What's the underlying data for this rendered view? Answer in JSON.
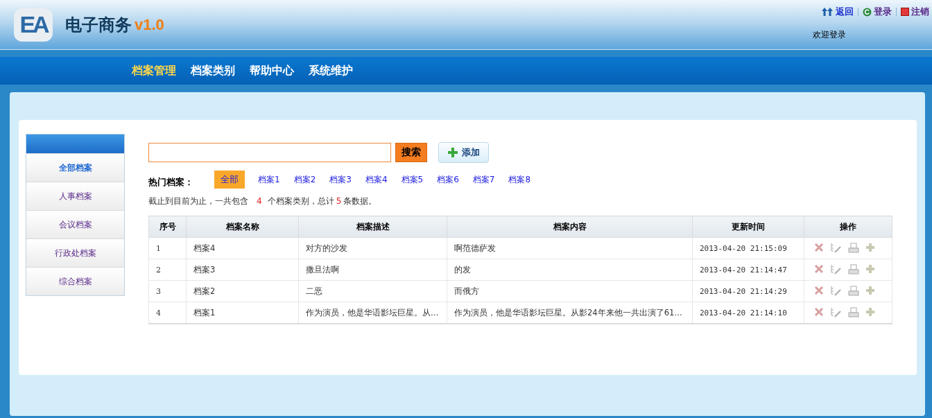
{
  "header": {
    "logo": "EA",
    "title": "电子商务",
    "version": "v1.0",
    "links": [
      {
        "kind": "back",
        "label": "返回"
      },
      {
        "kind": "login",
        "label": "登录"
      },
      {
        "kind": "logout",
        "label": "注销"
      }
    ],
    "welcome": "欢迎登录"
  },
  "nav": [
    {
      "label": "档案管理",
      "selected": true
    },
    {
      "label": "档案类别",
      "selected": false
    },
    {
      "label": "帮助中心",
      "selected": false
    },
    {
      "label": "系统维护",
      "selected": false
    }
  ],
  "sidebar": {
    "items": [
      {
        "label": "全部档案",
        "selected": true
      },
      {
        "label": "人事档案",
        "selected": false
      },
      {
        "label": "会议档案",
        "selected": false
      },
      {
        "label": "行政处档案",
        "selected": false
      },
      {
        "label": "综合档案",
        "selected": false
      }
    ]
  },
  "search": {
    "button": "搜索",
    "add_button": "添加"
  },
  "hot": {
    "label": "热门档案：",
    "tags": [
      {
        "label": "全部",
        "selected": true
      },
      {
        "label": "档案1",
        "selected": false
      },
      {
        "label": "档案2",
        "selected": false
      },
      {
        "label": "档案3",
        "selected": false
      },
      {
        "label": "档案4",
        "selected": false
      },
      {
        "label": "档案5",
        "selected": false
      },
      {
        "label": "档案6",
        "selected": false
      },
      {
        "label": "档案7",
        "selected": false
      },
      {
        "label": "档案8",
        "selected": false
      }
    ]
  },
  "summary": {
    "prefix": "截止到目前为止，一共包含",
    "categories": "4",
    "middle": "个档案类别，总计",
    "records": "5",
    "suffix": "条数据。"
  },
  "table": {
    "columns": [
      "序号",
      "档案名称",
      "档案描述",
      "档案内容",
      "更新时间",
      "操作"
    ],
    "rows": [
      {
        "no": "1",
        "name": "档案4",
        "description": "对方的沙发",
        "content": "啊范德萨发",
        "updated": "2013-04-20 21:15:09"
      },
      {
        "no": "2",
        "name": "档案3",
        "description": "撒旦法啊",
        "content": "的发",
        "updated": "2013-04-20 21:14:47"
      },
      {
        "no": "3",
        "name": "档案2",
        "description": "二恶",
        "content": "而俄方",
        "updated": "2013-04-20 21:14:29"
      },
      {
        "no": "4",
        "name": "档案1",
        "description": "作为演员，他是华语影坛巨星。从…",
        "content": "作为演员，他是华语影坛巨星。从影24年来他一共出演了61…",
        "updated": "2013-04-20 21:14:10"
      }
    ]
  }
}
